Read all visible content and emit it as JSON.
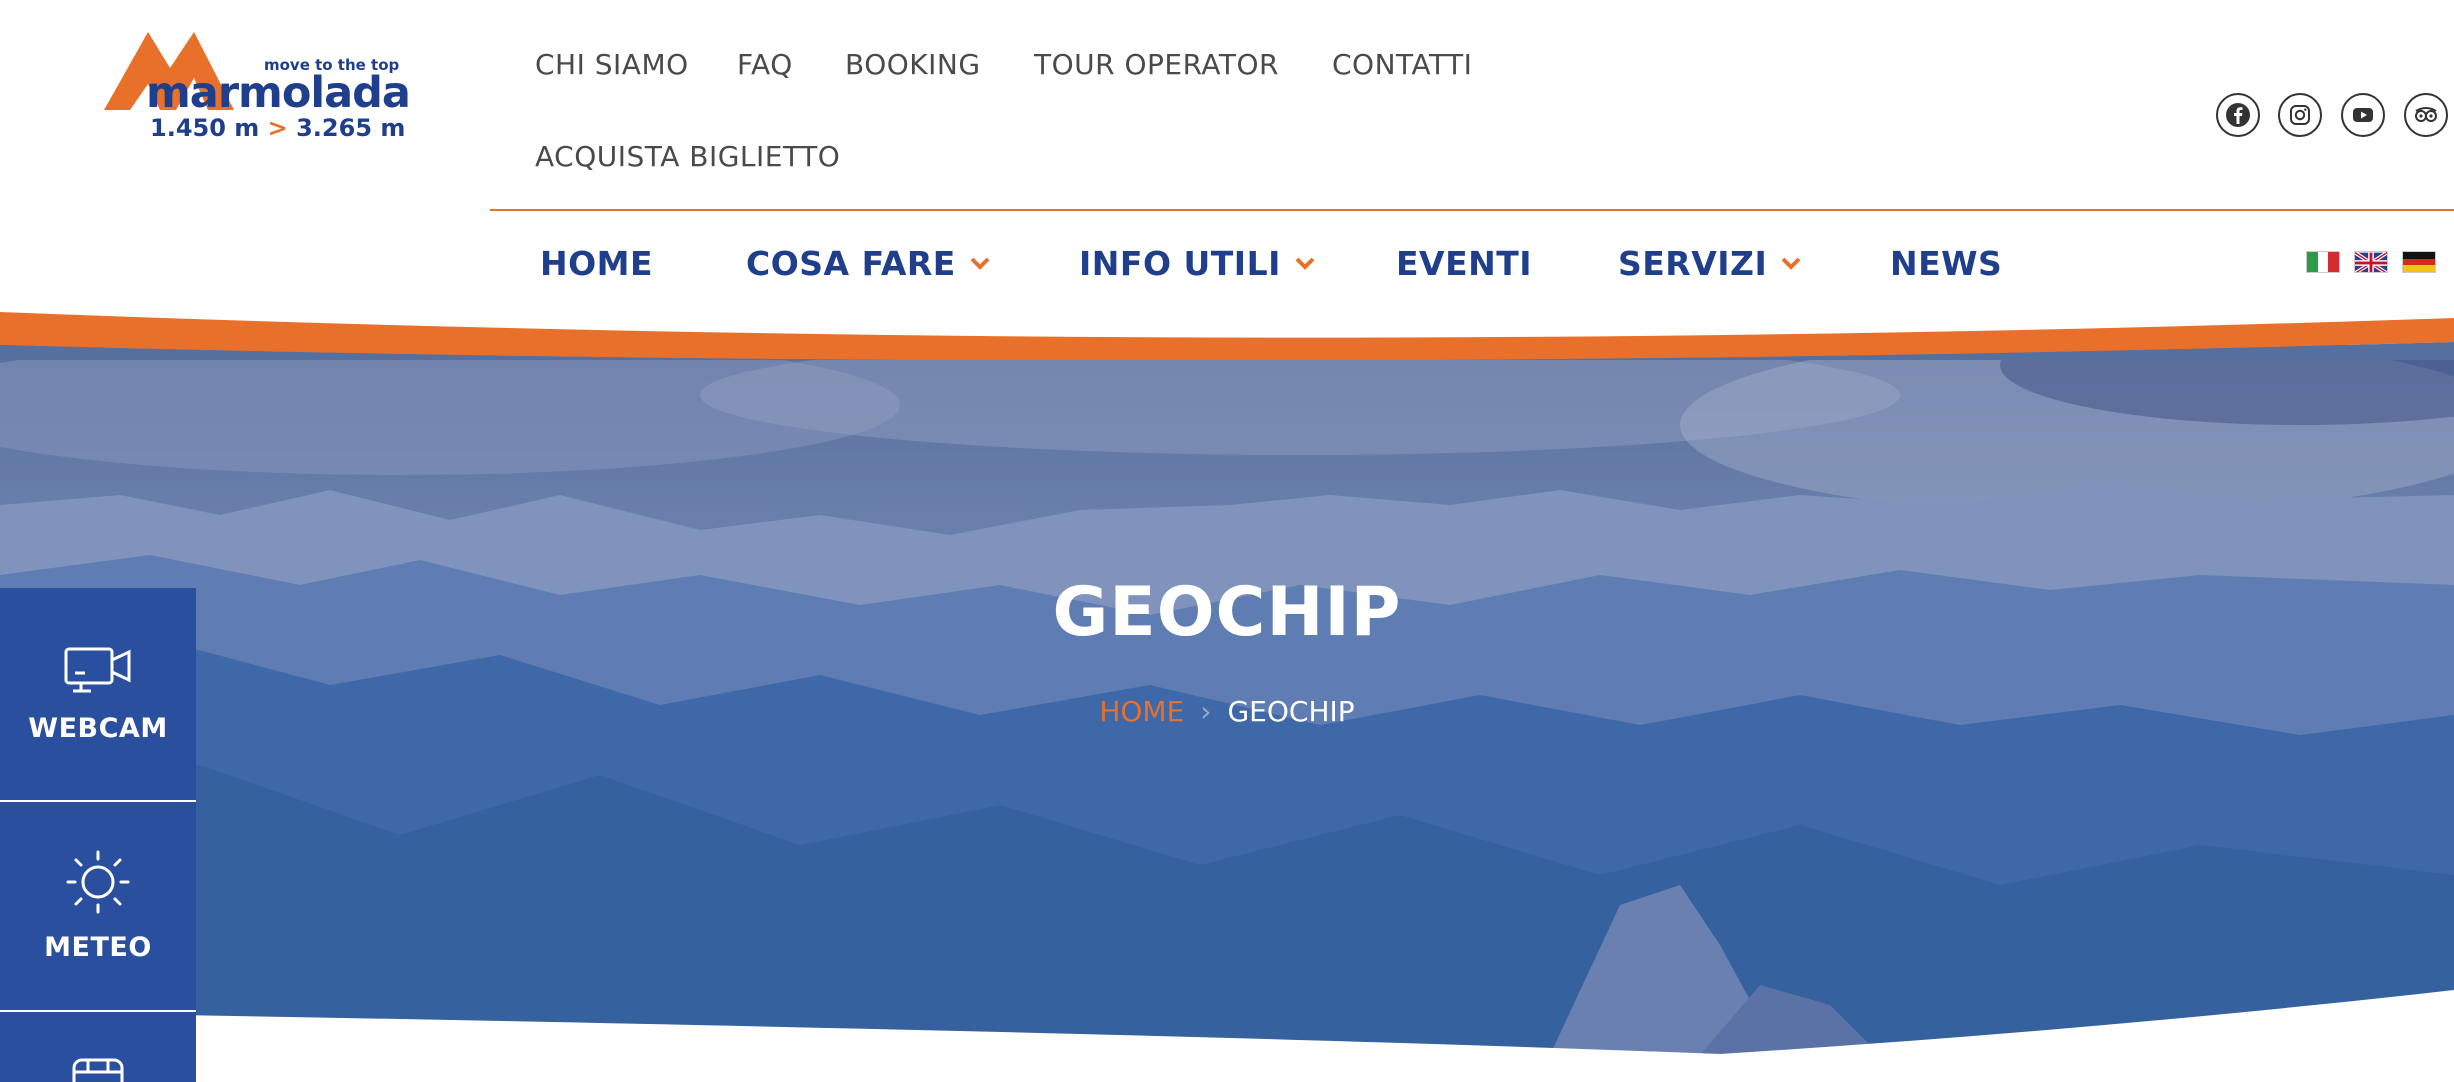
{
  "logo": {
    "tagline": "move to the top",
    "name": "marmolada",
    "altitude_low": "1.450 m",
    "altitude_sep": ">",
    "altitude_high": "3.265 m"
  },
  "top_menu": [
    "CHI SIAMO",
    "FAQ",
    "BOOKING",
    "TOUR OPERATOR",
    "CONTATTI",
    "ACQUISTA BIGLIETTO"
  ],
  "social": [
    {
      "icon": "facebook-icon"
    },
    {
      "icon": "instagram-icon"
    },
    {
      "icon": "youtube-icon"
    },
    {
      "icon": "tripadvisor-icon"
    }
  ],
  "main_nav": [
    {
      "label": "HOME",
      "dropdown": false
    },
    {
      "label": "COSA FARE",
      "dropdown": true
    },
    {
      "label": "INFO UTILI",
      "dropdown": true
    },
    {
      "label": "EVENTI",
      "dropdown": false
    },
    {
      "label": "SERVIZI",
      "dropdown": true
    },
    {
      "label": "NEWS",
      "dropdown": false
    }
  ],
  "languages": [
    "italian-flag-icon",
    "english-flag-icon",
    "german-flag-icon"
  ],
  "hero": {
    "title": "GEOCHIP",
    "breadcrumb_home": "HOME",
    "breadcrumb_sep": "›",
    "breadcrumb_current": "GEOCHIP"
  },
  "side_widgets": [
    {
      "label": "WEBCAM",
      "icon": "webcam-icon"
    },
    {
      "label": "METEO",
      "icon": "sun-icon"
    },
    {
      "label": "",
      "icon": "cable-car-icon"
    }
  ],
  "colors": {
    "brand_blue": "#1f3f8c",
    "accent_orange": "#e8702a",
    "widget_blue": "#2a4f9e",
    "hero_overlay": "#2b5aa8"
  }
}
